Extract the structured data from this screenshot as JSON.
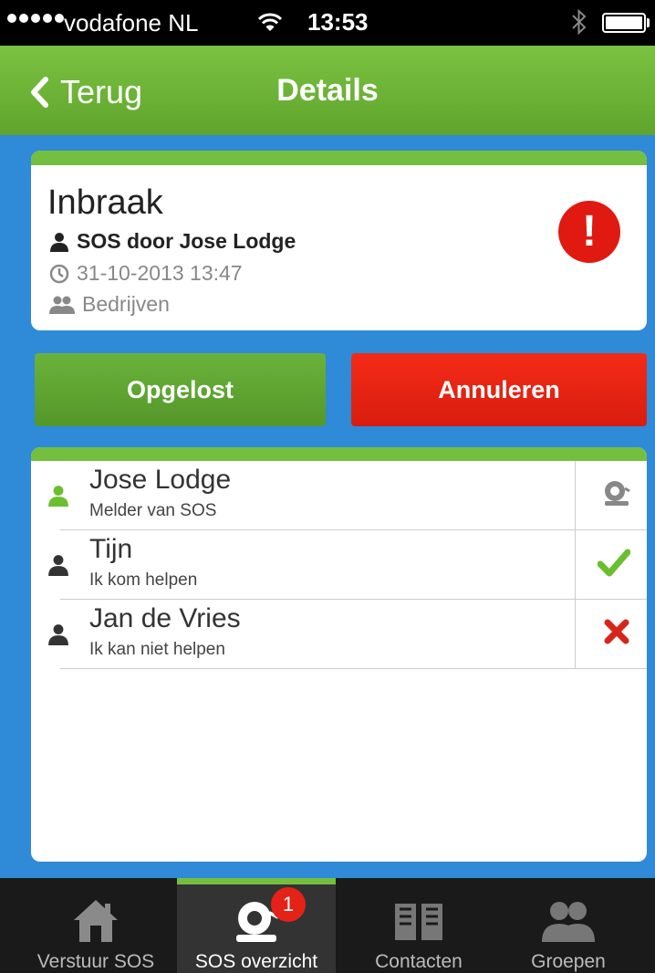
{
  "status_bar": {
    "carrier": "vodafone NL",
    "time": "13:53"
  },
  "nav": {
    "back_label": "Terug",
    "title": "Details"
  },
  "incident": {
    "name": "Inbraak",
    "reporter": "SOS door Jose Lodge",
    "datetime": "31-10-2013 13:47",
    "group": "Bedrijven",
    "alert_symbol": "!"
  },
  "actions": {
    "resolve_label": "Opgelost",
    "cancel_label": "Annuleren"
  },
  "responders": [
    {
      "name": "Jose Lodge",
      "status": "Melder van SOS",
      "icon": "alarm-bell-icon",
      "color": "#6abf2e"
    },
    {
      "name": "Tijn",
      "status": "Ik kom helpen",
      "icon": "check-icon",
      "color": "#6abf2e"
    },
    {
      "name": "Jan de Vries",
      "status": "Ik kan niet helpen",
      "icon": "cross-icon",
      "color": "#d8251b"
    }
  ],
  "tabs": [
    {
      "label": "Verstuur SOS",
      "icon": "home-icon"
    },
    {
      "label": "SOS overzicht",
      "icon": "alarm-bell-icon",
      "badge": "1",
      "active": true
    },
    {
      "label": "Contacten",
      "icon": "book-icon"
    },
    {
      "label": "Groepen",
      "icon": "group-icon"
    }
  ],
  "colors": {
    "brand_green": "#74bf3f",
    "background_blue": "#2f8ad7",
    "alert_red": "#e01a10"
  }
}
